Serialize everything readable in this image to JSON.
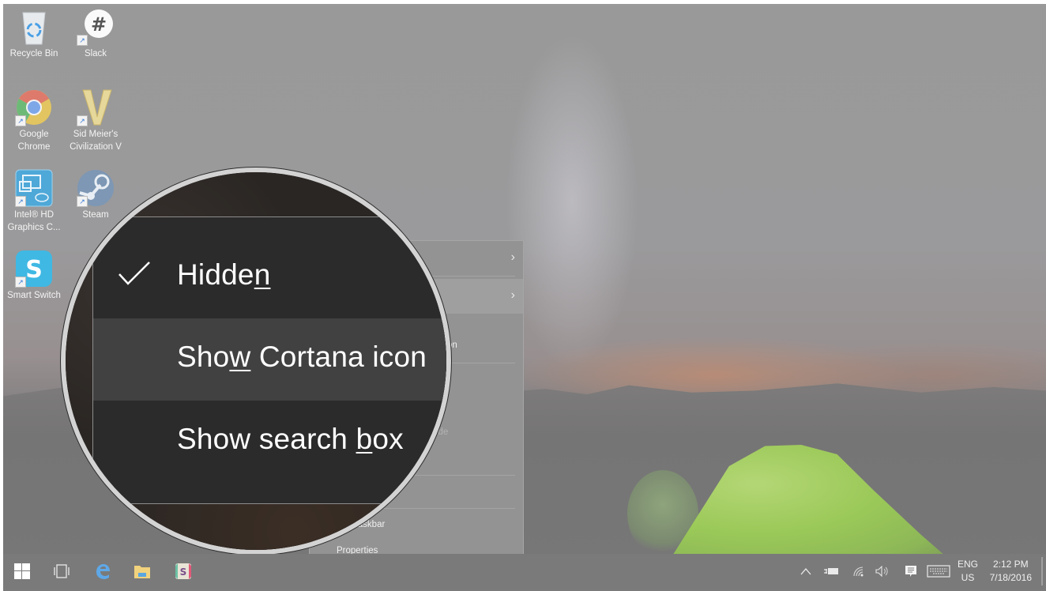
{
  "desktop": {
    "icons": [
      {
        "label": "Recycle Bin",
        "icon": "recycle-bin-icon",
        "shortcut": false
      },
      {
        "label": "Slack",
        "icon": "slack-icon",
        "shortcut": true
      },
      {
        "label": "Google Chrome",
        "icon": "chrome-icon",
        "shortcut": true
      },
      {
        "label": "Sid Meier's Civilization V",
        "icon": "civilization-v-icon",
        "shortcut": true
      },
      {
        "label": "Intel® HD Graphics C...",
        "icon": "intel-graphics-icon",
        "shortcut": true
      },
      {
        "label": "Steam",
        "icon": "steam-icon",
        "shortcut": true
      },
      {
        "label": "Smart Switch",
        "icon": "smart-switch-icon",
        "shortcut": true
      }
    ]
  },
  "context_menu": {
    "visible_fragments": [
      {
        "text": "on",
        "dim": false
      },
      {
        "text": "ide",
        "dim": true
      },
      {
        "text": "e taskbar",
        "dim": false
      },
      {
        "text": "Properties",
        "dim": false
      }
    ],
    "submenu_chevron": "›"
  },
  "magnifier": {
    "items": [
      {
        "before": "Hidde",
        "accel": "n",
        "after": "",
        "checked": true,
        "highlighted": false
      },
      {
        "before": "Sho",
        "accel": "w",
        "after": " Cortana icon",
        "checked": false,
        "highlighted": true
      },
      {
        "before": "Show search ",
        "accel": "b",
        "after": "ox",
        "checked": false,
        "highlighted": false
      }
    ]
  },
  "taskbar": {
    "pinned": [
      {
        "name": "start-button",
        "icon": "windows-logo-icon"
      },
      {
        "name": "task-view-button",
        "icon": "task-view-icon"
      },
      {
        "name": "edge-button",
        "icon": "edge-icon"
      },
      {
        "name": "file-explorer-button",
        "icon": "folder-icon"
      },
      {
        "name": "slack-taskbar-button",
        "icon": "slack-icon"
      }
    ],
    "tray": {
      "show_hidden": "^",
      "language_line1": "ENG",
      "language_line2": "US",
      "time": "2:12 PM",
      "date": "7/18/2016"
    }
  }
}
